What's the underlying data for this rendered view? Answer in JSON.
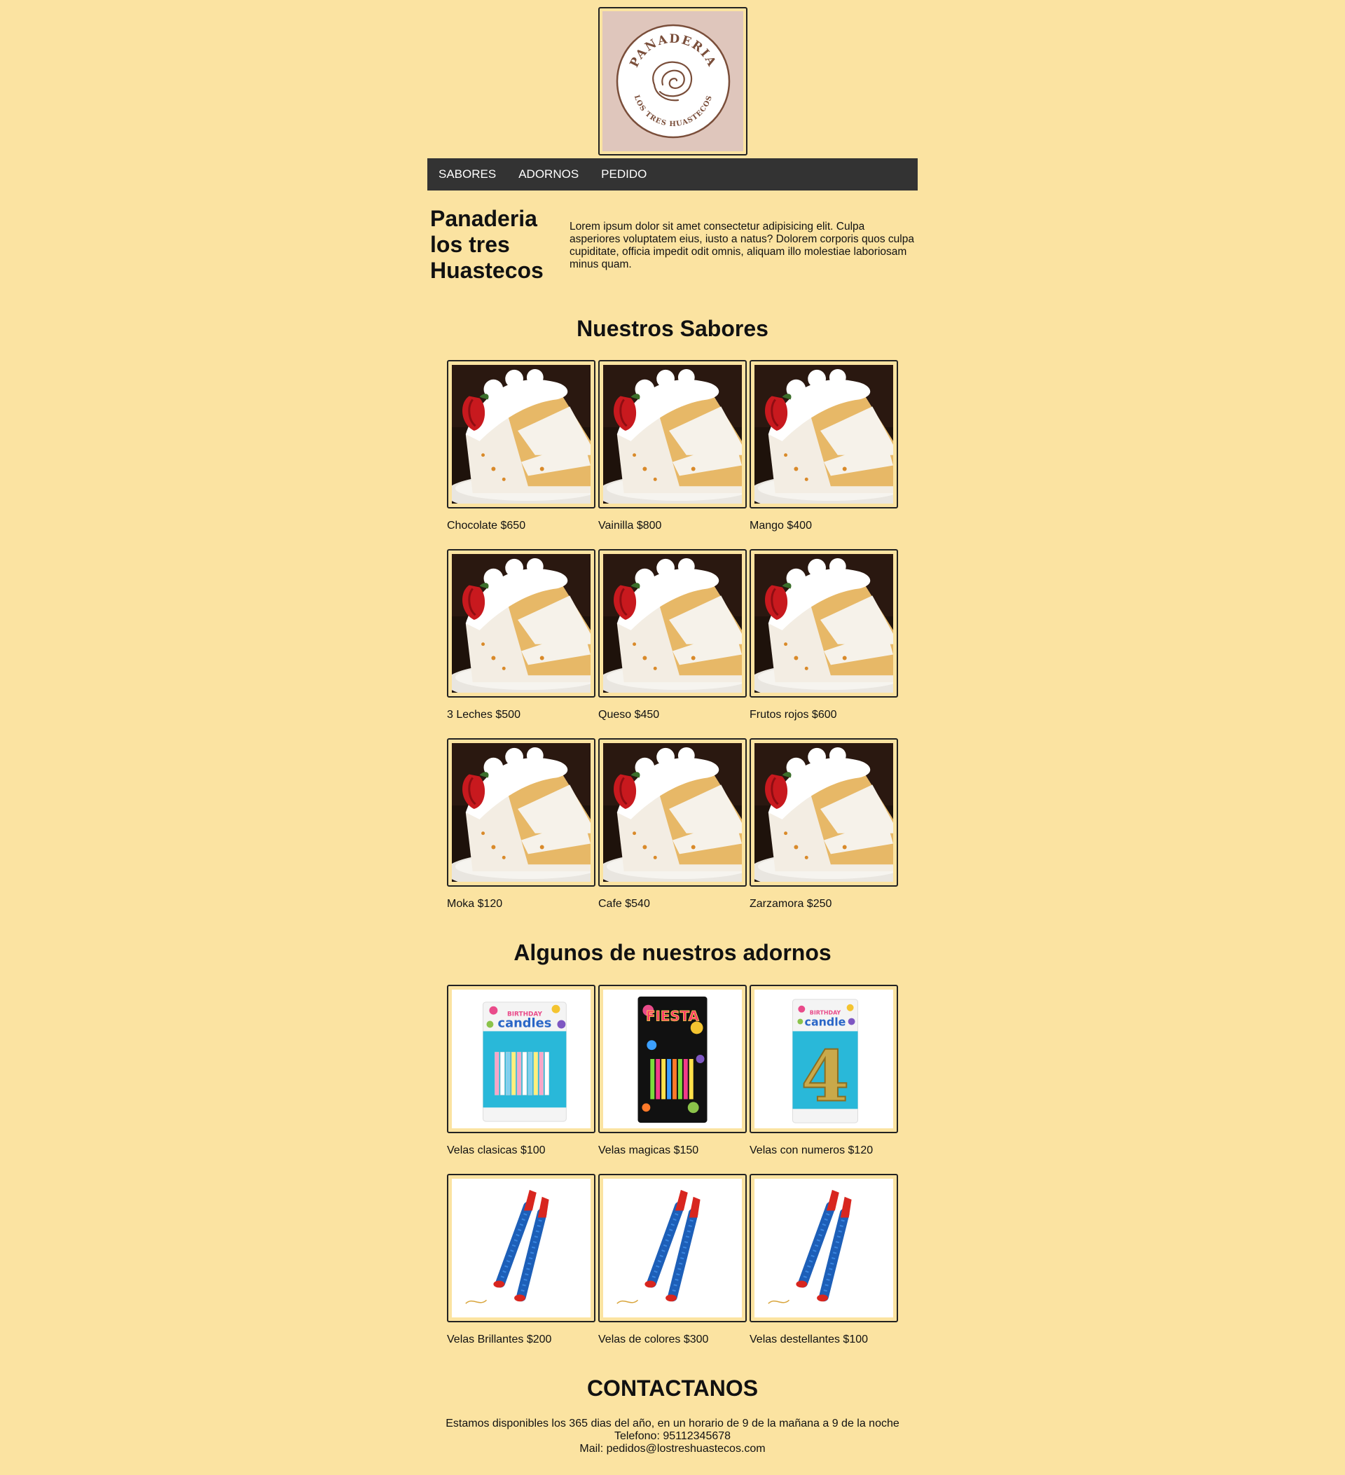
{
  "logo": {
    "top_text": "PANADERIA",
    "bottom_text": "LOS TRES HUASTECOS",
    "colors": {
      "bg": "#dfc6bc",
      "ring": "#7a4e3a"
    }
  },
  "nav": {
    "items": [
      "SABORES",
      "ADORNOS",
      "PEDIDO"
    ]
  },
  "intro": {
    "title": "Panaderia los tres Huastecos",
    "text": "Lorem ipsum dolor sit amet consectetur adipisicing elit. Culpa asperiores voluptatem eius, iusto a natus? Dolorem corporis quos culpa cupiditate, officia impedit odit omnis, aliquam illo molestiae laboriosam minus quam."
  },
  "sabores": {
    "heading": "Nuestros Sabores",
    "items": [
      {
        "label": "Chocolate $650"
      },
      {
        "label": "Vainilla $800"
      },
      {
        "label": "Mango $400"
      },
      {
        "label": "3 Leches $500"
      },
      {
        "label": "Queso $450"
      },
      {
        "label": "Frutos rojos $600"
      },
      {
        "label": "Moka $120"
      },
      {
        "label": "Cafe $540"
      },
      {
        "label": "Zarzamora $250"
      }
    ]
  },
  "adornos": {
    "heading": "Algunos de nuestros adornos",
    "items": [
      {
        "label": "Velas clasicas $100",
        "kind": "candles-pack"
      },
      {
        "label": "Velas magicas $150",
        "kind": "fiesta-pack"
      },
      {
        "label": "Velas con numeros $120",
        "kind": "number-candle"
      },
      {
        "label": "Velas Brillantes $200",
        "kind": "sparkler"
      },
      {
        "label": "Velas de colores $300",
        "kind": "sparkler"
      },
      {
        "label": "Velas destellantes $100",
        "kind": "sparkler"
      }
    ],
    "pack_text": {
      "birthday": "BIRTHDAY",
      "candles": "candles",
      "candle": "candle",
      "fiesta": "FIESTA",
      "number": "4"
    }
  },
  "contact": {
    "heading": "CONTACTANOS",
    "hours": "Estamos disponibles los 365 dias del año, en un horario de 9 de la mañana a 9 de la noche",
    "phone": "Telefono: 95112345678",
    "mail": "Mail: pedidos@lostreshuastecos.com"
  },
  "colors": {
    "page_bg": "#fbe3a1",
    "nav_bg": "#333333"
  }
}
